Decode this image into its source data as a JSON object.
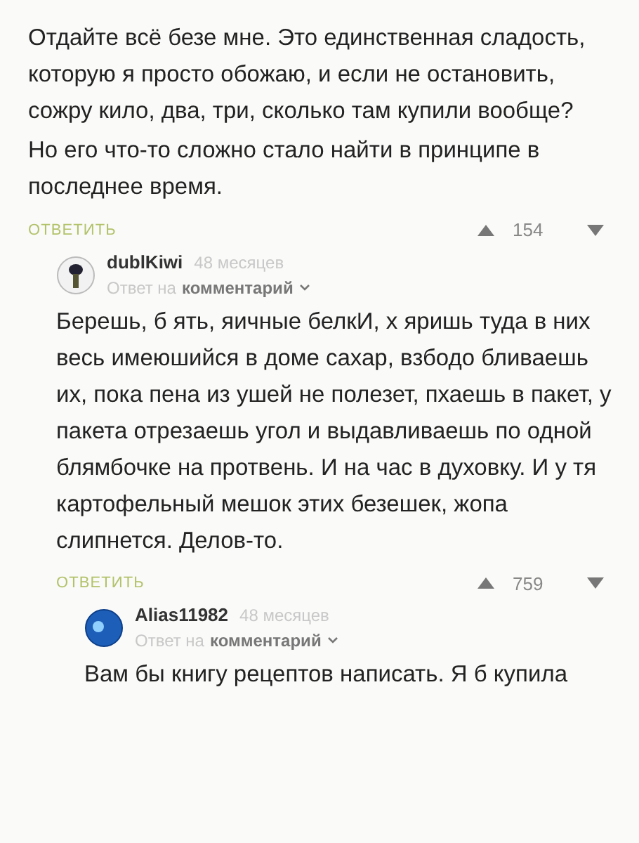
{
  "comment": {
    "body": [
      "Отдайте всё безе мне. Это единственная сладость, которую я просто обожаю, и если не остановить, сожру кило, два, три, сколько там купили вообще?",
      "Но его что-то сложно стало найти в принципе в последнее время."
    ],
    "reply_label": "ОТВЕТИТЬ",
    "rating": "154",
    "children": [
      {
        "author": "dublKiwi",
        "time": "48 месяцев",
        "reply_to": "Ответ на",
        "reply_target": "комментарий",
        "body": [
          "Берешь, б ять, яичные белкИ, х яришь туда в них весь имеюшийся в доме сахар, взбодо бливаешь их, пока пена из ушей не полезет, пхаешь в пакет, у пакета отрезаешь угол и выдавливаешь по одной блямбочке на протвень. И на час в духовку. И у тя картофельный мешок этих безешек, жопа слипнется. Делов-то."
        ],
        "reply_label": "ОТВЕТИТЬ",
        "rating": "759",
        "children": [
          {
            "author": "Alias11982",
            "time": "48 месяцев",
            "reply_to": "Ответ на",
            "reply_target": "комментарий",
            "body": [
              "Вам бы книгу рецептов написать. Я б купила"
            ]
          }
        ]
      }
    ]
  }
}
